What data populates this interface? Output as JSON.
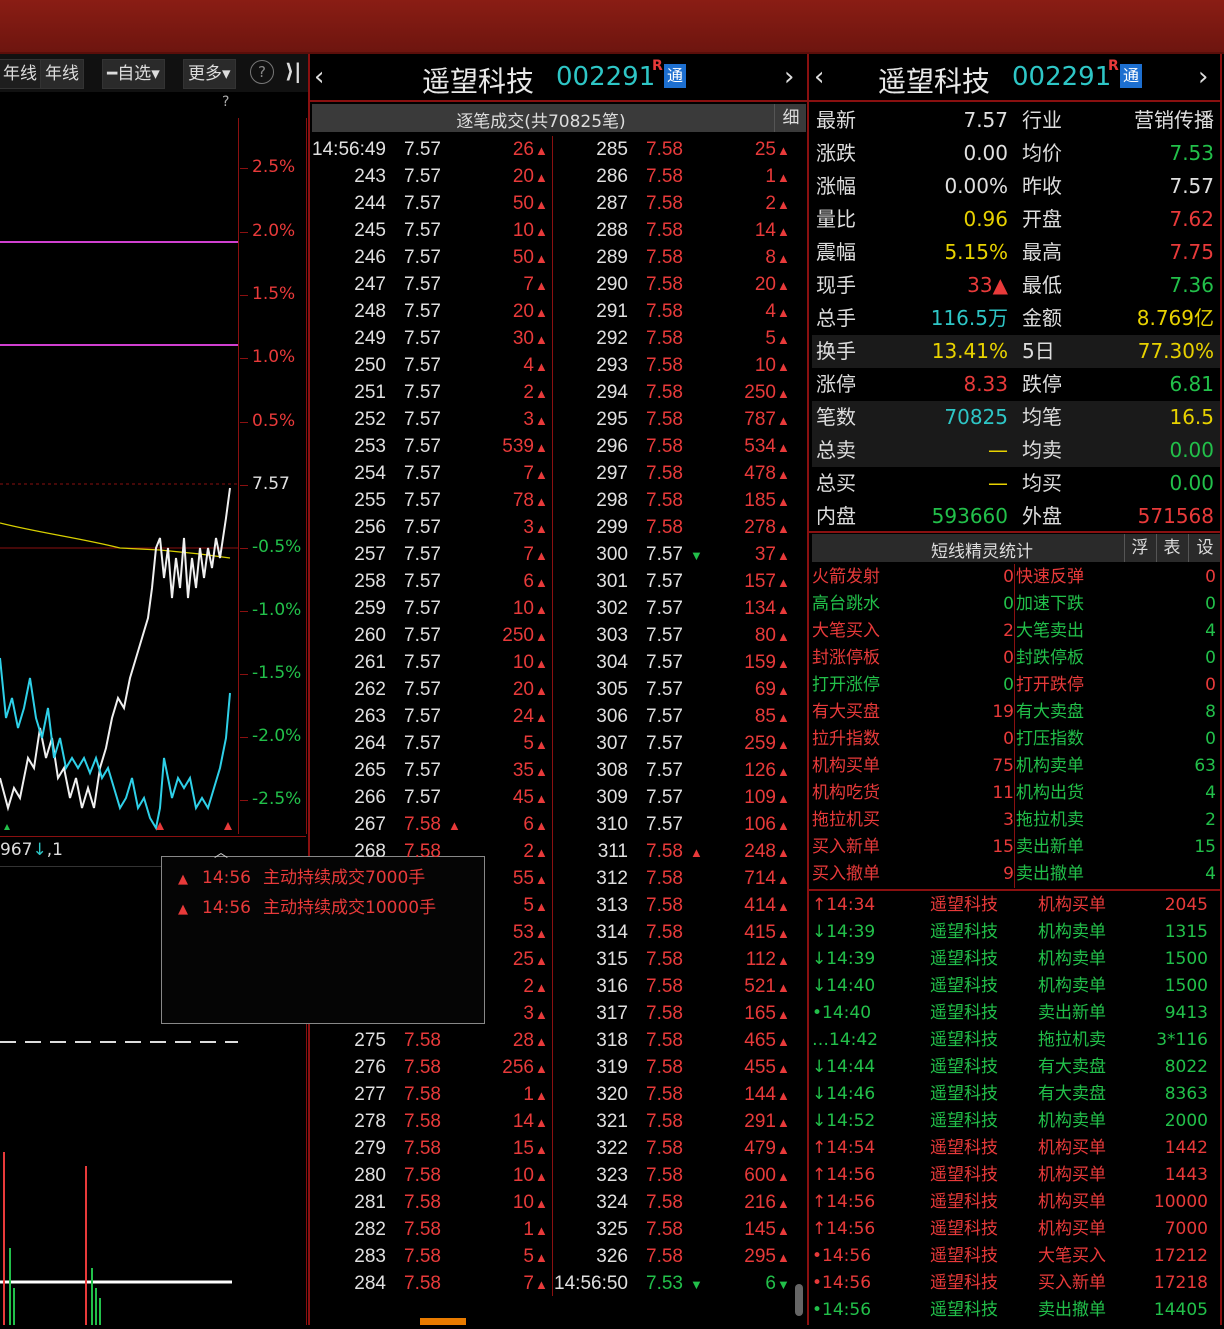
{
  "left": {
    "toolbar": {
      "btn1": "年线",
      "btn2": "年线",
      "btn3": "自选",
      "btn4": "更多",
      "help": "?",
      "collapse": "⟩|"
    },
    "q_mark": "?",
    "pct_labels": [
      {
        "t": "2.5%",
        "c": "red"
      },
      {
        "t": "2.0%",
        "c": "red"
      },
      {
        "t": "1.5%",
        "c": "red"
      },
      {
        "t": "1.0%",
        "c": "red"
      },
      {
        "t": "0.5%",
        "c": "red"
      },
      {
        "t": "7.57",
        "c": "wht"
      },
      {
        "t": "-0.5%",
        "c": "grn"
      },
      {
        "t": "-1.0%",
        "c": "grn"
      },
      {
        "t": "-1.5%",
        "c": "grn"
      },
      {
        "t": "-2.0%",
        "c": "grn"
      },
      {
        "t": "-2.5%",
        "c": "grn"
      }
    ],
    "volume_readout_prefix": "967",
    "volume_readout_suffix": ",1"
  },
  "popup": {
    "items": [
      {
        "time": "14:56",
        "text": "主动持续成交7000手"
      },
      {
        "time": "14:56",
        "text": "主动持续成交10000手"
      }
    ]
  },
  "middle": {
    "name": "遥望科技",
    "code": "002291",
    "badge_r": "R",
    "badge": "通",
    "subtitle": "逐笔成交(共70825笔)",
    "detail_btn": "细",
    "left_rows": [
      {
        "t": "14:56:49",
        "p": "7.57",
        "v": "26",
        "d": "up",
        "pc": "wht"
      },
      {
        "t": "243",
        "p": "7.57",
        "v": "20",
        "d": "up",
        "pc": "wht"
      },
      {
        "t": "244",
        "p": "7.57",
        "v": "50",
        "d": "up",
        "pc": "wht"
      },
      {
        "t": "245",
        "p": "7.57",
        "v": "10",
        "d": "up",
        "pc": "wht"
      },
      {
        "t": "246",
        "p": "7.57",
        "v": "50",
        "d": "up",
        "pc": "wht"
      },
      {
        "t": "247",
        "p": "7.57",
        "v": "7",
        "d": "up",
        "pc": "wht"
      },
      {
        "t": "248",
        "p": "7.57",
        "v": "20",
        "d": "up",
        "pc": "wht"
      },
      {
        "t": "249",
        "p": "7.57",
        "v": "30",
        "d": "up",
        "pc": "wht"
      },
      {
        "t": "250",
        "p": "7.57",
        "v": "4",
        "d": "up",
        "pc": "wht"
      },
      {
        "t": "251",
        "p": "7.57",
        "v": "2",
        "d": "up",
        "pc": "wht"
      },
      {
        "t": "252",
        "p": "7.57",
        "v": "3",
        "d": "up",
        "pc": "wht"
      },
      {
        "t": "253",
        "p": "7.57",
        "v": "539",
        "d": "up",
        "pc": "wht"
      },
      {
        "t": "254",
        "p": "7.57",
        "v": "7",
        "d": "up",
        "pc": "wht"
      },
      {
        "t": "255",
        "p": "7.57",
        "v": "78",
        "d": "up",
        "pc": "wht"
      },
      {
        "t": "256",
        "p": "7.57",
        "v": "3",
        "d": "up",
        "pc": "wht"
      },
      {
        "t": "257",
        "p": "7.57",
        "v": "7",
        "d": "up",
        "pc": "wht"
      },
      {
        "t": "258",
        "p": "7.57",
        "v": "6",
        "d": "up",
        "pc": "wht"
      },
      {
        "t": "259",
        "p": "7.57",
        "v": "10",
        "d": "up",
        "pc": "wht"
      },
      {
        "t": "260",
        "p": "7.57",
        "v": "250",
        "d": "up",
        "pc": "wht"
      },
      {
        "t": "261",
        "p": "7.57",
        "v": "10",
        "d": "up",
        "pc": "wht"
      },
      {
        "t": "262",
        "p": "7.57",
        "v": "20",
        "d": "up",
        "pc": "wht"
      },
      {
        "t": "263",
        "p": "7.57",
        "v": "24",
        "d": "up",
        "pc": "wht"
      },
      {
        "t": "264",
        "p": "7.57",
        "v": "5",
        "d": "up",
        "pc": "wht"
      },
      {
        "t": "265",
        "p": "7.57",
        "v": "35",
        "d": "up",
        "pc": "wht"
      },
      {
        "t": "266",
        "p": "7.57",
        "v": "45",
        "d": "up",
        "pc": "wht"
      },
      {
        "t": "267",
        "p": "7.58",
        "v": "6",
        "d": "up",
        "pc": "red",
        "pa": "up"
      },
      {
        "t": "268",
        "p": "7.58",
        "v": "2",
        "d": "up",
        "pc": "red"
      },
      {
        "t": "",
        "p": "",
        "v": "55",
        "d": "up",
        "pc": "red"
      },
      {
        "t": "",
        "p": "",
        "v": "5",
        "d": "up",
        "pc": "red"
      },
      {
        "t": "",
        "p": "",
        "v": "53",
        "d": "up",
        "pc": "red"
      },
      {
        "t": "",
        "p": "",
        "v": "25",
        "d": "up",
        "pc": "red"
      },
      {
        "t": "",
        "p": "",
        "v": "2",
        "d": "up",
        "pc": "red"
      },
      {
        "t": "",
        "p": "",
        "v": "3",
        "d": "up",
        "pc": "red"
      },
      {
        "t": "275",
        "p": "7.58",
        "v": "28",
        "d": "up",
        "pc": "red"
      },
      {
        "t": "276",
        "p": "7.58",
        "v": "256",
        "d": "up",
        "pc": "red"
      },
      {
        "t": "277",
        "p": "7.58",
        "v": "1",
        "d": "up",
        "pc": "red"
      },
      {
        "t": "278",
        "p": "7.58",
        "v": "14",
        "d": "up",
        "pc": "red"
      },
      {
        "t": "279",
        "p": "7.58",
        "v": "15",
        "d": "up",
        "pc": "red"
      },
      {
        "t": "280",
        "p": "7.58",
        "v": "10",
        "d": "up",
        "pc": "red"
      },
      {
        "t": "281",
        "p": "7.58",
        "v": "10",
        "d": "up",
        "pc": "red"
      },
      {
        "t": "282",
        "p": "7.58",
        "v": "1",
        "d": "up",
        "pc": "red"
      },
      {
        "t": "283",
        "p": "7.58",
        "v": "5",
        "d": "up",
        "pc": "red"
      },
      {
        "t": "284",
        "p": "7.58",
        "v": "7",
        "d": "up",
        "pc": "red"
      }
    ],
    "right_rows": [
      {
        "t": "285",
        "p": "7.58",
        "v": "25",
        "d": "up",
        "pc": "red"
      },
      {
        "t": "286",
        "p": "7.58",
        "v": "1",
        "d": "up",
        "pc": "red"
      },
      {
        "t": "287",
        "p": "7.58",
        "v": "2",
        "d": "up",
        "pc": "red"
      },
      {
        "t": "288",
        "p": "7.58",
        "v": "14",
        "d": "up",
        "pc": "red"
      },
      {
        "t": "289",
        "p": "7.58",
        "v": "8",
        "d": "up",
        "pc": "red"
      },
      {
        "t": "290",
        "p": "7.58",
        "v": "20",
        "d": "up",
        "pc": "red"
      },
      {
        "t": "291",
        "p": "7.58",
        "v": "4",
        "d": "up",
        "pc": "red"
      },
      {
        "t": "292",
        "p": "7.58",
        "v": "5",
        "d": "up",
        "pc": "red"
      },
      {
        "t": "293",
        "p": "7.58",
        "v": "10",
        "d": "up",
        "pc": "red"
      },
      {
        "t": "294",
        "p": "7.58",
        "v": "250",
        "d": "up",
        "pc": "red"
      },
      {
        "t": "295",
        "p": "7.58",
        "v": "787",
        "d": "up",
        "pc": "red"
      },
      {
        "t": "296",
        "p": "7.58",
        "v": "534",
        "d": "up",
        "pc": "red"
      },
      {
        "t": "297",
        "p": "7.58",
        "v": "478",
        "d": "up",
        "pc": "red"
      },
      {
        "t": "298",
        "p": "7.58",
        "v": "185",
        "d": "up",
        "pc": "red"
      },
      {
        "t": "299",
        "p": "7.58",
        "v": "278",
        "d": "up",
        "pc": "red"
      },
      {
        "t": "300",
        "p": "7.57",
        "v": "37",
        "d": "up",
        "pc": "wht",
        "pa": "dn"
      },
      {
        "t": "301",
        "p": "7.57",
        "v": "157",
        "d": "up",
        "pc": "wht"
      },
      {
        "t": "302",
        "p": "7.57",
        "v": "134",
        "d": "up",
        "pc": "wht"
      },
      {
        "t": "303",
        "p": "7.57",
        "v": "80",
        "d": "up",
        "pc": "wht"
      },
      {
        "t": "304",
        "p": "7.57",
        "v": "159",
        "d": "up",
        "pc": "wht"
      },
      {
        "t": "305",
        "p": "7.57",
        "v": "69",
        "d": "up",
        "pc": "wht"
      },
      {
        "t": "306",
        "p": "7.57",
        "v": "85",
        "d": "up",
        "pc": "wht"
      },
      {
        "t": "307",
        "p": "7.57",
        "v": "259",
        "d": "up",
        "pc": "wht"
      },
      {
        "t": "308",
        "p": "7.57",
        "v": "126",
        "d": "up",
        "pc": "wht"
      },
      {
        "t": "309",
        "p": "7.57",
        "v": "109",
        "d": "up",
        "pc": "wht"
      },
      {
        "t": "310",
        "p": "7.57",
        "v": "106",
        "d": "up",
        "pc": "wht"
      },
      {
        "t": "311",
        "p": "7.58",
        "v": "248",
        "d": "up",
        "pc": "red",
        "pa": "up"
      },
      {
        "t": "312",
        "p": "7.58",
        "v": "714",
        "d": "up",
        "pc": "red"
      },
      {
        "t": "313",
        "p": "7.58",
        "v": "414",
        "d": "up",
        "pc": "red"
      },
      {
        "t": "314",
        "p": "7.58",
        "v": "415",
        "d": "up",
        "pc": "red"
      },
      {
        "t": "315",
        "p": "7.58",
        "v": "112",
        "d": "up",
        "pc": "red"
      },
      {
        "t": "316",
        "p": "7.58",
        "v": "521",
        "d": "up",
        "pc": "red"
      },
      {
        "t": "317",
        "p": "7.58",
        "v": "165",
        "d": "up",
        "pc": "red"
      },
      {
        "t": "318",
        "p": "7.58",
        "v": "465",
        "d": "up",
        "pc": "red"
      },
      {
        "t": "319",
        "p": "7.58",
        "v": "455",
        "d": "up",
        "pc": "red"
      },
      {
        "t": "320",
        "p": "7.58",
        "v": "144",
        "d": "up",
        "pc": "red"
      },
      {
        "t": "321",
        "p": "7.58",
        "v": "291",
        "d": "up",
        "pc": "red"
      },
      {
        "t": "322",
        "p": "7.58",
        "v": "479",
        "d": "up",
        "pc": "red"
      },
      {
        "t": "323",
        "p": "7.58",
        "v": "600",
        "d": "up",
        "pc": "red"
      },
      {
        "t": "324",
        "p": "7.58",
        "v": "216",
        "d": "up",
        "pc": "red"
      },
      {
        "t": "325",
        "p": "7.58",
        "v": "145",
        "d": "up",
        "pc": "red"
      },
      {
        "t": "326",
        "p": "7.58",
        "v": "295",
        "d": "up",
        "pc": "red"
      },
      {
        "t": "14:56:50",
        "p": "7.53",
        "v": "6",
        "d": "dn",
        "pc": "grn",
        "pa": "dn"
      }
    ]
  },
  "right": {
    "name": "遥望科技",
    "code": "002291",
    "badge_r": "R",
    "badge": "通",
    "quote_rows": [
      {
        "l1": "最新",
        "v1": "7.57",
        "c1": "wht",
        "l2": "行业",
        "v2": "营销传播",
        "c2": "wht"
      },
      {
        "l1": "涨跌",
        "v1": "0.00",
        "c1": "wht",
        "l2": "均价",
        "v2": "7.53",
        "c2": "grn"
      },
      {
        "l1": "涨幅",
        "v1": "0.00%",
        "c1": "wht",
        "l2": "昨收",
        "v2": "7.57",
        "c2": "wht"
      },
      {
        "l1": "量比",
        "v1": "0.96",
        "c1": "yel",
        "l2": "开盘",
        "v2": "7.62",
        "c2": "red"
      },
      {
        "l1": "震幅",
        "v1": "5.15%",
        "c1": "yel",
        "l2": "最高",
        "v2": "7.75",
        "c2": "red"
      },
      {
        "l1": "现手",
        "v1": "33▲",
        "c1": "red",
        "l2": "最低",
        "v2": "7.36",
        "c2": "grn"
      },
      {
        "l1": "总手",
        "v1": "116.5万",
        "c1": "cyn",
        "l2": "金额",
        "v2": "8.769亿",
        "c2": "yel"
      },
      {
        "l1": "换手",
        "v1": "13.41%",
        "c1": "yel",
        "l2": "5日",
        "v2": "77.30%",
        "c2": "yel"
      },
      {
        "l1": "涨停",
        "v1": "8.33",
        "c1": "red",
        "l2": "跌停",
        "v2": "6.81",
        "c2": "grn"
      },
      {
        "l1": "笔数",
        "v1": "70825",
        "c1": "cyn",
        "l2": "均笔",
        "v2": "16.5",
        "c2": "yel"
      },
      {
        "l1": "总卖",
        "v1": "—",
        "c1": "yel",
        "l2": "均卖",
        "v2": "0.00",
        "c2": "grn"
      },
      {
        "l1": "总买",
        "v1": "—",
        "c1": "yel",
        "l2": "均买",
        "v2": "0.00",
        "c2": "grn"
      },
      {
        "l1": "内盘",
        "v1": "593660",
        "c1": "grn",
        "l2": "外盘",
        "v2": "571568",
        "c2": "red"
      }
    ],
    "sprite_title": "短线精灵统计",
    "sprite_btns": [
      "浮",
      "表",
      "设"
    ],
    "sprite_rows": [
      {
        "l1": "火箭发射",
        "v1": "0",
        "c1": "red",
        "l2": "快速反弹",
        "v2": "0",
        "c2": "red"
      },
      {
        "l1": "高台跳水",
        "v1": "0",
        "c1": "grn",
        "l2": "加速下跌",
        "v2": "0",
        "c2": "grn"
      },
      {
        "l1": "大笔买入",
        "v1": "2",
        "c1": "red",
        "l2": "大笔卖出",
        "v2": "4",
        "c2": "grn"
      },
      {
        "l1": "封涨停板",
        "v1": "0",
        "c1": "red",
        "l2": "封跌停板",
        "v2": "0",
        "c2": "grn"
      },
      {
        "l1": "打开涨停",
        "v1": "0",
        "c1": "grn",
        "l2": "打开跌停",
        "v2": "0",
        "c2": "red"
      },
      {
        "l1": "有大买盘",
        "v1": "19",
        "c1": "red",
        "l2": "有大卖盘",
        "v2": "8",
        "c2": "grn"
      },
      {
        "l1": "拉升指数",
        "v1": "0",
        "c1": "red",
        "l2": "打压指数",
        "v2": "0",
        "c2": "grn"
      },
      {
        "l1": "机构买单",
        "v1": "75",
        "c1": "red",
        "l2": "机构卖单",
        "v2": "63",
        "c2": "grn"
      },
      {
        "l1": "机构吃货",
        "v1": "11",
        "c1": "red",
        "l2": "机构出货",
        "v2": "4",
        "c2": "grn"
      },
      {
        "l1": "拖拉机买",
        "v1": "3",
        "c1": "red",
        "l2": "拖拉机卖",
        "v2": "2",
        "c2": "grn"
      },
      {
        "l1": "买入新单",
        "v1": "15",
        "c1": "red",
        "l2": "卖出新单",
        "v2": "15",
        "c2": "grn"
      },
      {
        "l1": "买入撤单",
        "v1": "9",
        "c1": "red",
        "l2": "卖出撤单",
        "v2": "4",
        "c2": "grn"
      }
    ],
    "feed_rows": [
      {
        "time": "↑14:34",
        "name": "遥望科技",
        "ev": "机构买单",
        "val": "2045",
        "c": "red"
      },
      {
        "time": "↓14:39",
        "name": "遥望科技",
        "ev": "机构卖单",
        "val": "1315",
        "c": "grn"
      },
      {
        "time": "↓14:39",
        "name": "遥望科技",
        "ev": "机构卖单",
        "val": "1500",
        "c": "grn"
      },
      {
        "time": "↓14:40",
        "name": "遥望科技",
        "ev": "机构卖单",
        "val": "1500",
        "c": "grn"
      },
      {
        "time": "•14:40",
        "name": "遥望科技",
        "ev": "卖出新单",
        "val": "9413",
        "c": "grn"
      },
      {
        "time": "…14:42",
        "name": "遥望科技",
        "ev": "拖拉机卖",
        "val": "3*116",
        "c": "grn"
      },
      {
        "time": "↓14:44",
        "name": "遥望科技",
        "ev": "有大卖盘",
        "val": "8022",
        "c": "grn"
      },
      {
        "time": "↓14:46",
        "name": "遥望科技",
        "ev": "有大卖盘",
        "val": "8363",
        "c": "grn"
      },
      {
        "time": "↓14:52",
        "name": "遥望科技",
        "ev": "机构卖单",
        "val": "2000",
        "c": "grn"
      },
      {
        "time": "↑14:54",
        "name": "遥望科技",
        "ev": "机构买单",
        "val": "1442",
        "c": "red"
      },
      {
        "time": "↑14:56",
        "name": "遥望科技",
        "ev": "机构买单",
        "val": "1443",
        "c": "red"
      },
      {
        "time": "↑14:56",
        "name": "遥望科技",
        "ev": "机构买单",
        "val": "10000",
        "c": "red"
      },
      {
        "time": "↑14:56",
        "name": "遥望科技",
        "ev": "机构买单",
        "val": "7000",
        "c": "red"
      },
      {
        "time": "•14:56",
        "name": "遥望科技",
        "ev": "大笔买入",
        "val": "17212",
        "c": "red"
      },
      {
        "time": "•14:56",
        "name": "遥望科技",
        "ev": "买入新单",
        "val": "17218",
        "c": "red"
      },
      {
        "time": "•14:56",
        "name": "遥望科技",
        "ev": "卖出撤单",
        "val": "14405",
        "c": "grn"
      }
    ]
  }
}
